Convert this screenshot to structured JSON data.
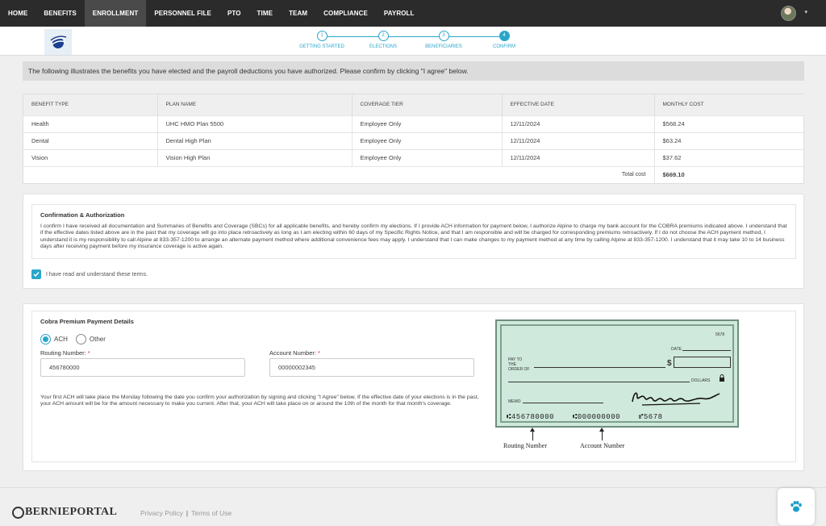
{
  "nav": {
    "items": [
      {
        "label": "HOME",
        "active": false
      },
      {
        "label": "BENEFITS",
        "active": false
      },
      {
        "label": "ENROLLMENT",
        "active": true
      },
      {
        "label": "PERSONNEL FILE",
        "active": false
      },
      {
        "label": "PTO",
        "active": false
      },
      {
        "label": "TIME",
        "active": false
      },
      {
        "label": "TEAM",
        "active": false
      },
      {
        "label": "COMPLIANCE",
        "active": false
      },
      {
        "label": "PAYROLL",
        "active": false
      }
    ],
    "caret": "▾"
  },
  "steps": [
    {
      "num": "1",
      "label": "GETTING STARTED"
    },
    {
      "num": "2",
      "label": "ELECTIONS"
    },
    {
      "num": "3",
      "label": "BENEFICIARIES"
    },
    {
      "num": "4",
      "label": "CONFIRM"
    }
  ],
  "active_step": 4,
  "banner": "The following illustrates the benefits you have elected and the payroll deductions you have authorized. Please confirm by clicking \"I agree\" below.",
  "table": {
    "headers": [
      "BENEFIT TYPE",
      "PLAN NAME",
      "COVERAGE TIER",
      "EFFECTIVE DATE",
      "MONTHLY COST"
    ],
    "rows": [
      [
        "Health",
        "UHC HMO Plan 5500",
        "Employee Only",
        "12/11/2024",
        "$568.24"
      ],
      [
        "Dental",
        "Dental High Plan",
        "Employee Only",
        "12/11/2024",
        "$63.24"
      ],
      [
        "Vision",
        "Vision High Plan",
        "Employee Only",
        "12/11/2024",
        "$37.62"
      ]
    ],
    "total_label": "Total cost",
    "total_value": "$669.10"
  },
  "authorization": {
    "title": "Confirmation & Authorization",
    "text": "I confirm I have received all documentation and Summaries of Benefits and Coverage (SBCs) for all applicable benefits, and hereby confirm my elections. If I provide ACH information for payment below, I authorize Alpine to charge my bank account for the COBRA premiums indicated above. I understand that if the effective dates listed above are in the past that my coverage will go into place retroactively as long as I am electing within 60 days of my Specific Rights Notice, and that I am responsible and will be charged for corresponding premiums retroactively. If I do not choose the ACH payment method, I understand it is my responsibility to call Alpine at 833-357-1200 to arrange an alternate payment method where additional convenience fees may apply. I understand that I can make changes to my payment method at any time by calling Alpine at 833-357-1200. I understand that it may take 10 to 14 business days after receiving payment before my insurance coverage is active again.",
    "checkbox_label": "I have read and understand these terms.",
    "checked": true
  },
  "payment": {
    "title": "Cobra Premium Payment Details",
    "options": [
      "ACH",
      "Other"
    ],
    "selected": "ACH",
    "routing_label": "Routing Number:",
    "routing_value": "456780000",
    "account_label": "Account Number:",
    "account_value": "00000002345",
    "required_mark": "*",
    "ach_note": "Your first ACH will take place the Monday following the date you confirm your authorization by signing and clicking \"I Agree\" below. If the effective date of your elections is in the past, your ACH amount will be for the amount necessary to make you current. After that, your ACH will take place on or around the 10th of the month for that month's coverage."
  },
  "check_image": {
    "number": "5678",
    "date_label": "DATE",
    "pay_to_label": "PAY TO THE ORDER OF",
    "dollar_sign": "$",
    "dollars_label": "DOLLARS",
    "memo_label": "MEMO",
    "micr_routing": "⑆456780000",
    "micr_account": "⑆000000000",
    "micr_check": "⑈5678",
    "routing_caption": "Routing Number",
    "account_caption": "Account Number"
  },
  "footer": {
    "brand": "BERNIEPORTAL",
    "privacy": "Privacy Policy",
    "separator": "|",
    "terms": "Terms of Use"
  }
}
